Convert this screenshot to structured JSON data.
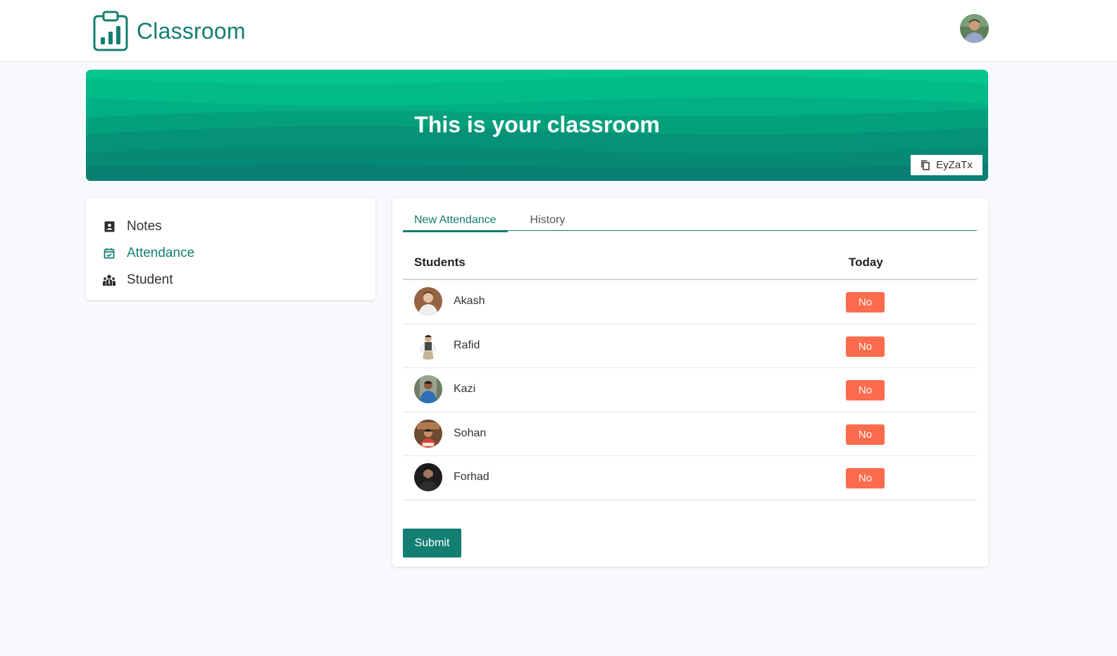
{
  "header": {
    "brand_name": "Classroom",
    "brand_icon": "clipboard-chart-icon",
    "user_avatar": "user-avatar"
  },
  "banner": {
    "title": "This is your classroom",
    "class_code": "EyZaTx",
    "code_icon": "copy-icon"
  },
  "sidebar": {
    "items": [
      {
        "label": "Notes",
        "icon": "contact-book-icon",
        "active": false
      },
      {
        "label": "Attendance",
        "icon": "calendar-check-icon",
        "active": true
      },
      {
        "label": "Student",
        "icon": "people-icon",
        "active": false
      }
    ]
  },
  "attendance": {
    "tabs": [
      {
        "label": "New Attendance",
        "active": true
      },
      {
        "label": "History",
        "active": false
      }
    ],
    "columns": {
      "students": "Students",
      "today": "Today"
    },
    "rows": [
      {
        "name": "Akash",
        "status": "No"
      },
      {
        "name": "Rafid",
        "status": "No"
      },
      {
        "name": "Kazi",
        "status": "No"
      },
      {
        "name": "Sohan",
        "status": "No"
      },
      {
        "name": "Forhad",
        "status": "No"
      }
    ],
    "submit_label": "Submit"
  },
  "colors": {
    "primary": "#137e72",
    "banner_light": "#04c58f",
    "banner_dark": "#087f72",
    "no_button": "#fd6b4d",
    "background": "#f8f9fd"
  }
}
